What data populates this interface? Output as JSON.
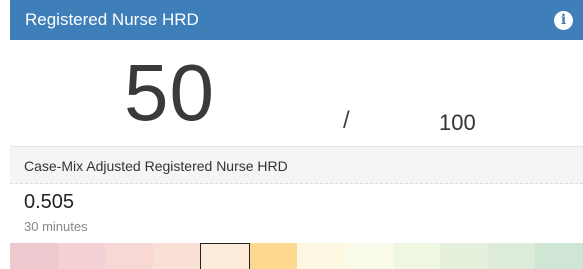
{
  "header": {
    "title": "Registered Nurse HRD",
    "info_icon": "info-icon"
  },
  "score": {
    "value": "50",
    "separator": "/",
    "max": "100"
  },
  "metric": {
    "label": "Case-Mix Adjusted Registered Nurse HRD",
    "value": "0.505",
    "unit": "30 minutes"
  },
  "scale": {
    "colors": [
      "#ebc9cf",
      "#f3d1d4",
      "#f7d8d5",
      "#f9e0d7",
      "#fcebd9",
      "#fdd890",
      "#fdf6e0",
      "#fafbea",
      "#eff7e2",
      "#e5f1dc",
      "#dcecd8",
      "#cfe6d4"
    ],
    "active_index": 4
  },
  "colors": {
    "header_bg": "#3e7eb9",
    "header_text": "#ffffff"
  }
}
